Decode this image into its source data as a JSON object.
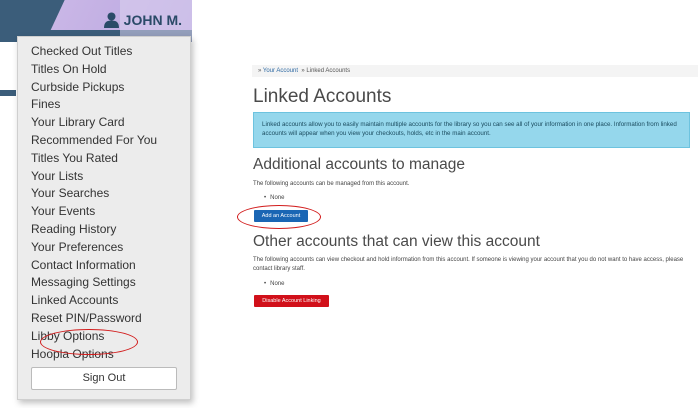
{
  "header": {
    "user_name": "JOHN M."
  },
  "menu": {
    "items": [
      {
        "label": "Checked Out Titles"
      },
      {
        "label": "Titles On Hold"
      },
      {
        "label": "Curbside Pickups"
      },
      {
        "label": "Fines"
      },
      {
        "label": "Your Library Card"
      },
      {
        "label": "Recommended For You"
      },
      {
        "label": "Titles You Rated"
      },
      {
        "label": "Your Lists"
      },
      {
        "label": "Your Searches"
      },
      {
        "label": "Your Events"
      },
      {
        "label": "Reading History"
      },
      {
        "label": "Your Preferences"
      },
      {
        "label": "Contact Information"
      },
      {
        "label": "Messaging Settings"
      },
      {
        "label": "Linked Accounts"
      },
      {
        "label": "Reset PIN/Password"
      },
      {
        "label": "Libby Options"
      },
      {
        "label": "Hoopla Options"
      }
    ],
    "sign_out": "Sign Out"
  },
  "breadcrumb": {
    "sep1": "»",
    "link": "Your Account",
    "sep2": "»",
    "current": "Linked Accounts"
  },
  "page": {
    "title": "Linked Accounts",
    "info": "Linked accounts allow you to easily maintain multiple accounts for the library so you can see all of your information in one place. Information from linked accounts will appear when you view your checkouts, holds, etc in the main account.",
    "manage": {
      "heading": "Additional accounts to manage",
      "description": "The following accounts can be managed from this account.",
      "list_item": "None",
      "button": "Add an Account"
    },
    "viewers": {
      "heading": "Other accounts that can view this account",
      "description": "The following accounts can view checkout and hold information from this account. If someone is viewing your account that you do not want to have access, please contact library staff.",
      "list_item": "None",
      "button": "Disable Account Linking"
    }
  },
  "colors": {
    "annotation": "#d21c1c",
    "primary_button": "#1a66b4",
    "danger_button": "#d1101a",
    "info_bg": "#95d7ec"
  }
}
